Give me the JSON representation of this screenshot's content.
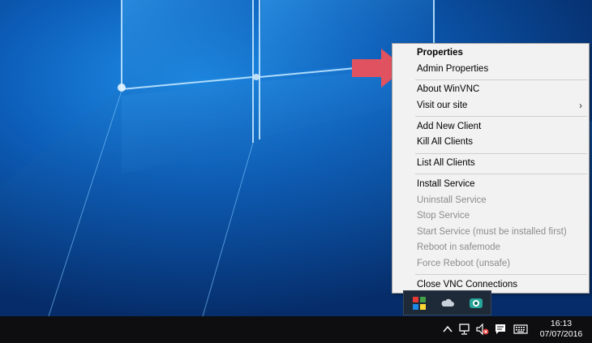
{
  "menu": {
    "items": [
      {
        "label": "Properties",
        "style": "bold"
      },
      {
        "label": "Admin Properties",
        "style": "normal"
      },
      {
        "separator": true
      },
      {
        "label": "About WinVNC",
        "style": "normal"
      },
      {
        "label": "Visit our site",
        "style": "normal",
        "submenu": true
      },
      {
        "separator": true
      },
      {
        "label": "Add New Client",
        "style": "normal"
      },
      {
        "label": "Kill All Clients",
        "style": "normal"
      },
      {
        "separator": true
      },
      {
        "label": "List All Clients",
        "style": "normal"
      },
      {
        "separator": true
      },
      {
        "label": "Install Service",
        "style": "normal"
      },
      {
        "label": "Uninstall Service",
        "style": "disabled"
      },
      {
        "label": "Stop Service",
        "style": "disabled"
      },
      {
        "label": "Start Service (must be installed first)",
        "style": "disabled"
      },
      {
        "label": "Reboot in safemode",
        "style": "disabled"
      },
      {
        "label": "Force Reboot (unsafe)",
        "style": "disabled"
      },
      {
        "separator": true
      },
      {
        "label": "Close VNC Connections",
        "style": "normal"
      }
    ],
    "submenu_chevron": "›"
  },
  "annotation": {
    "arrow_color": "#e0525f",
    "arrow_target": "Admin Properties"
  },
  "tray_overflow": {
    "icons": [
      "ultravnc-icon",
      "onedrive-cloud-icon",
      "webcam-icon"
    ]
  },
  "taskbar": {
    "tray_icons": [
      "chevron-up-icon",
      "network-icon",
      "volume-muted-icon",
      "action-center-icon",
      "keyboard-icon"
    ],
    "clock": {
      "time": "16:13",
      "date": "07/07/2016"
    }
  },
  "colors": {
    "desktop_blue": "#0a3f86",
    "menu_bg": "#f2f2f2",
    "taskbar_bg": "#0e0e10",
    "disabled_text": "#8c8c8c"
  }
}
